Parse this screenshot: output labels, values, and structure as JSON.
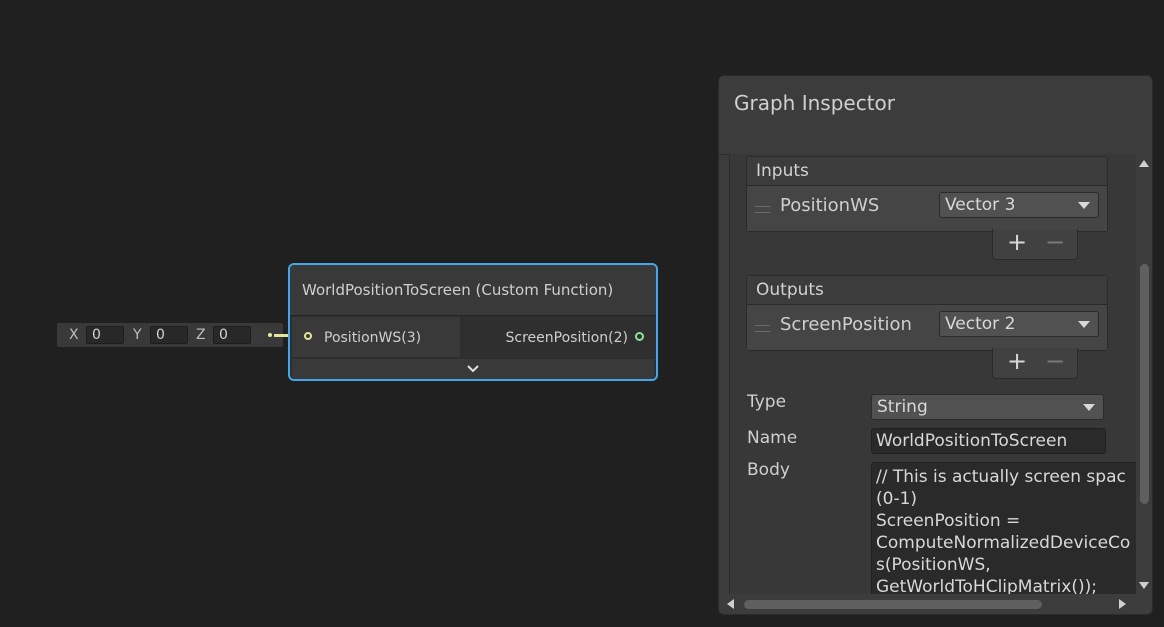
{
  "vector_input": {
    "x_label": "X",
    "x_value": "0",
    "y_label": "Y",
    "y_value": "0",
    "z_label": "Z",
    "z_value": "0"
  },
  "node": {
    "title": "WorldPositionToScreen (Custom Function)",
    "input_port": "PositionWS(3)",
    "output_port": "ScreenPosition(2)",
    "expand_icon": "chevron-down-icon"
  },
  "inspector": {
    "title": "Graph Inspector",
    "inputs": {
      "header": "Inputs",
      "rows": [
        {
          "name": "PositionWS",
          "type": "Vector 3"
        }
      ],
      "add": "+",
      "remove": "−"
    },
    "outputs": {
      "header": "Outputs",
      "rows": [
        {
          "name": "ScreenPosition",
          "type": "Vector 2"
        }
      ],
      "add": "+",
      "remove": "−"
    },
    "type_label": "Type",
    "type_value": "String",
    "name_label": "Name",
    "name_value": "WorldPositionToScreen",
    "body_label": "Body",
    "body_value": "// This is actually screen spac\n(0-1)\nScreenPosition =\nComputeNormalizedDeviceCo\ns(PositionWS,\nGetWorldToHClipMatrix());"
  },
  "colors": {
    "selection_outline": "#44a8e8",
    "vector3_port": "#e5e59a",
    "vector2_port": "#8fe29a"
  }
}
